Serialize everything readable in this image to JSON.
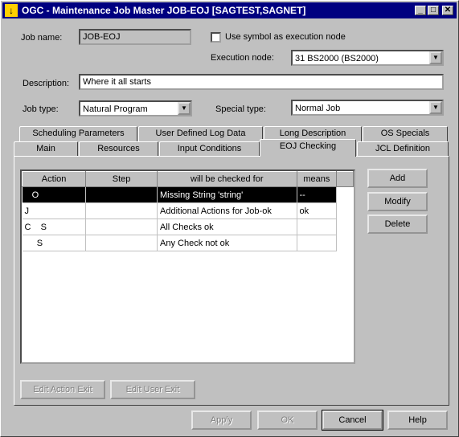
{
  "window": {
    "title": "OGC - Maintenance Job Master JOB-EOJ [SAGTEST,SAGNET]",
    "icon": "warning-down-arrow-icon",
    "minimize_glyph": "_",
    "maximize_glyph": "□",
    "close_glyph": "✕"
  },
  "form": {
    "job_name_label": "Job name:",
    "job_name_value": "JOB-EOJ",
    "use_symbol_label": "Use symbol as execution node",
    "execution_node_label": "Execution node:",
    "execution_node_value": "31      BS2000 (BS2000)",
    "description_label": "Description:",
    "description_value": "Where it all starts",
    "job_type_label": "Job type:",
    "job_type_value": "Natural Program",
    "special_type_label": "Special type:",
    "special_type_value": "Normal Job",
    "dropdown_glyph": "▼"
  },
  "tabs_back": [
    {
      "label": "Scheduling Parameters"
    },
    {
      "label": "User Defined Log Data"
    },
    {
      "label": "Long Description"
    },
    {
      "label": "OS Specials"
    }
  ],
  "tabs_front": [
    {
      "label": "Main"
    },
    {
      "label": "Resources"
    },
    {
      "label": "Input Conditions"
    },
    {
      "label": "EOJ Checking"
    },
    {
      "label": "JCL Definition"
    }
  ],
  "table": {
    "headers": [
      "Action",
      "Step",
      "will be checked for",
      "means"
    ],
    "rows": [
      {
        "action": "   O",
        "step": "",
        "checked_for": "Missing String 'string'",
        "means": "--",
        "selected": true
      },
      {
        "action": "J",
        "step": "",
        "checked_for": "Additional Actions for Job-ok",
        "means": "ok",
        "selected": false
      },
      {
        "action": "C    S",
        "step": "",
        "checked_for": "All Checks ok",
        "means": "",
        "selected": false
      },
      {
        "action": "     S",
        "step": "",
        "checked_for": "Any Check not ok",
        "means": "",
        "selected": false
      }
    ]
  },
  "side_buttons": {
    "add": "Add",
    "modify": "Modify",
    "delete": "Delete"
  },
  "exit_buttons": {
    "edit_action_exit": "Edit Action Exit",
    "edit_user_exit": "Edit User Exit"
  },
  "footer_buttons": {
    "apply": "Apply",
    "ok": "OK",
    "cancel": "Cancel",
    "help": "Help"
  }
}
